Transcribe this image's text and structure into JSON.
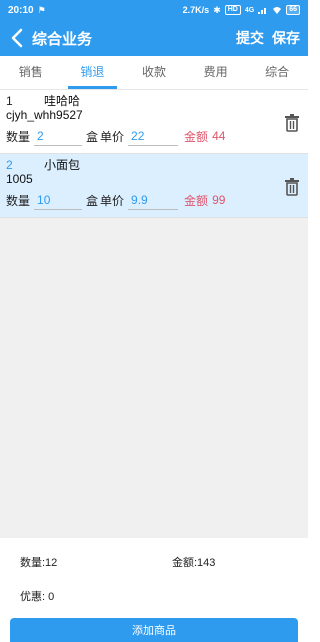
{
  "status": {
    "time": "20:10",
    "net_speed": "2.7K/s",
    "hd_label": "HD",
    "signal_text": "4G",
    "battery": "66"
  },
  "header": {
    "title": "综合业务",
    "submit_label": "提交",
    "save_label": "保存"
  },
  "tabs": [
    {
      "label": "销售"
    },
    {
      "label": "销退"
    },
    {
      "label": "收款"
    },
    {
      "label": "费用"
    },
    {
      "label": "综合"
    }
  ],
  "active_tab": "销退",
  "items": [
    {
      "index": "1",
      "name": "哇哈哈",
      "code": "cjyh_whh9527",
      "qty_label": "数量",
      "qty": "2",
      "unit": "盒",
      "price_label": "单价",
      "price": "22",
      "amount_label": "金额",
      "amount": "44"
    },
    {
      "index": "2",
      "name": "小面包",
      "code": "1005",
      "qty_label": "数量",
      "qty": "10",
      "unit": "盒",
      "price_label": "单价",
      "price": "9.9",
      "amount_label": "金额",
      "amount": "99"
    }
  ],
  "summary": {
    "quantity": "数量:12",
    "amount": "金额:143",
    "discount": "优惠:  0"
  },
  "add_button_label": "添加商品",
  "colors": {
    "primary": "#2f9bef",
    "amount": "#e0556a",
    "selected_row": "#dcefff"
  }
}
